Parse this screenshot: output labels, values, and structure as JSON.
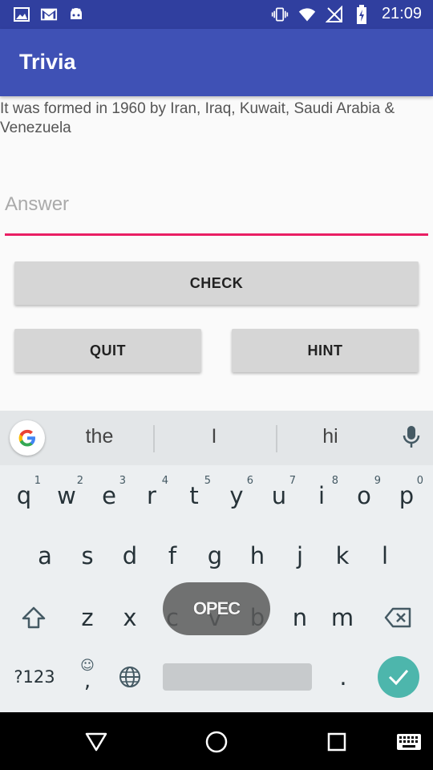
{
  "status_bar": {
    "time": "21:09",
    "left_icons": [
      "image-icon",
      "gmail-icon",
      "android-icon"
    ],
    "right_icons": [
      "vibrate-icon",
      "wifi-icon",
      "no-signal-icon",
      "battery-charging-icon"
    ]
  },
  "app_bar": {
    "title": "Trivia"
  },
  "question": {
    "text": "It was formed in 1960 by Iran, Iraq, Kuwait, Saudi Arabia & Venezuela"
  },
  "answer_input": {
    "value": "",
    "placeholder": "Answer"
  },
  "buttons": {
    "check": "CHECK",
    "quit": "QUIT",
    "hint": "HINT"
  },
  "keyboard": {
    "suggestions": [
      "the",
      "I",
      "hi"
    ],
    "row1": [
      {
        "k": "q",
        "h": "1"
      },
      {
        "k": "w",
        "h": "2"
      },
      {
        "k": "e",
        "h": "3"
      },
      {
        "k": "r",
        "h": "4"
      },
      {
        "k": "t",
        "h": "5"
      },
      {
        "k": "y",
        "h": "6"
      },
      {
        "k": "u",
        "h": "7"
      },
      {
        "k": "i",
        "h": "8"
      },
      {
        "k": "o",
        "h": "9"
      },
      {
        "k": "p",
        "h": "0"
      }
    ],
    "row2": [
      "a",
      "s",
      "d",
      "f",
      "g",
      "h",
      "j",
      "k",
      "l"
    ],
    "row3": [
      "z",
      "x",
      "c",
      "v",
      "b",
      "n",
      "m"
    ],
    "symbols_label": "?123",
    "emoji_comma": ",",
    "period": ".",
    "popup_text": "OPEC"
  },
  "colors": {
    "status_bar": "#303f9f",
    "app_bar": "#3f51b5",
    "input_underline": "#e91e63",
    "enter_key": "#4db6ac"
  },
  "nav": [
    "back-icon",
    "home-icon",
    "recents-icon",
    "keyboard-switch-icon"
  ]
}
